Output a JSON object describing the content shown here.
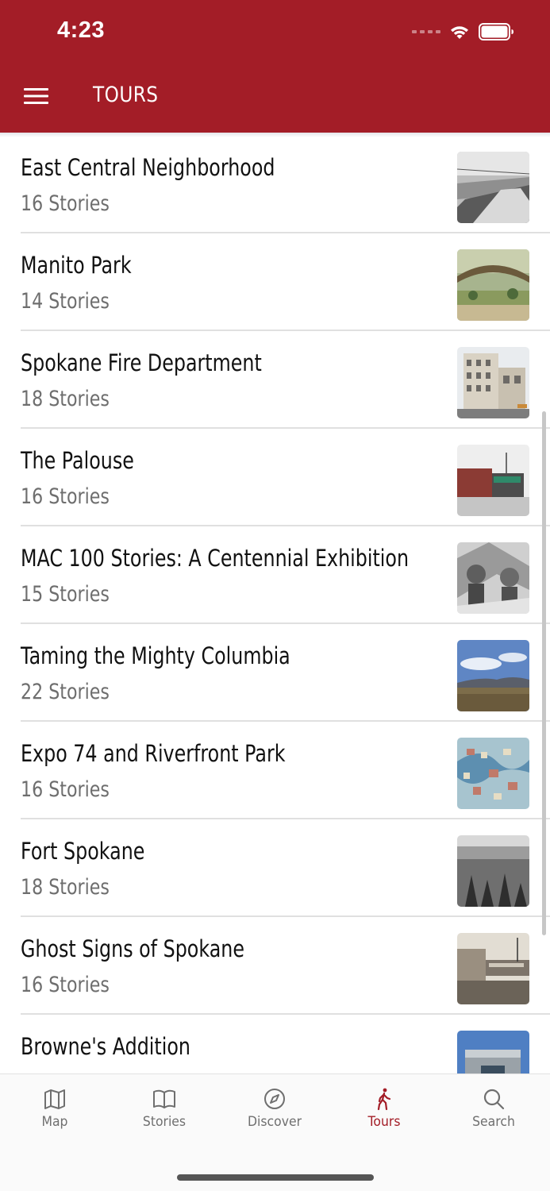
{
  "status": {
    "time": "4:23"
  },
  "header": {
    "title": "TOURS"
  },
  "tours": [
    {
      "title": "East Central Neighborhood",
      "count": "16 Stories"
    },
    {
      "title": "Manito Park",
      "count": "14 Stories"
    },
    {
      "title": "Spokane Fire Department",
      "count": "18 Stories"
    },
    {
      "title": "The Palouse",
      "count": "16 Stories"
    },
    {
      "title": "MAC 100 Stories: A Centennial Exhibition",
      "count": "15 Stories"
    },
    {
      "title": "Taming the Mighty Columbia",
      "count": "22 Stories"
    },
    {
      "title": "Expo 74 and Riverfront Park",
      "count": "16 Stories"
    },
    {
      "title": "Fort Spokane",
      "count": "18 Stories"
    },
    {
      "title": "Ghost Signs of Spokane",
      "count": "16 Stories"
    },
    {
      "title": "Browne's Addition",
      "count": ""
    }
  ],
  "tabs": [
    {
      "label": "Map",
      "icon": "map-icon"
    },
    {
      "label": "Stories",
      "icon": "book-icon"
    },
    {
      "label": "Discover",
      "icon": "compass-icon"
    },
    {
      "label": "Tours",
      "icon": "walking-person-icon",
      "active": true
    },
    {
      "label": "Search",
      "icon": "search-icon"
    }
  ],
  "colors": {
    "brand": "#a31d27",
    "tab_inactive": "#6f6f6f"
  }
}
